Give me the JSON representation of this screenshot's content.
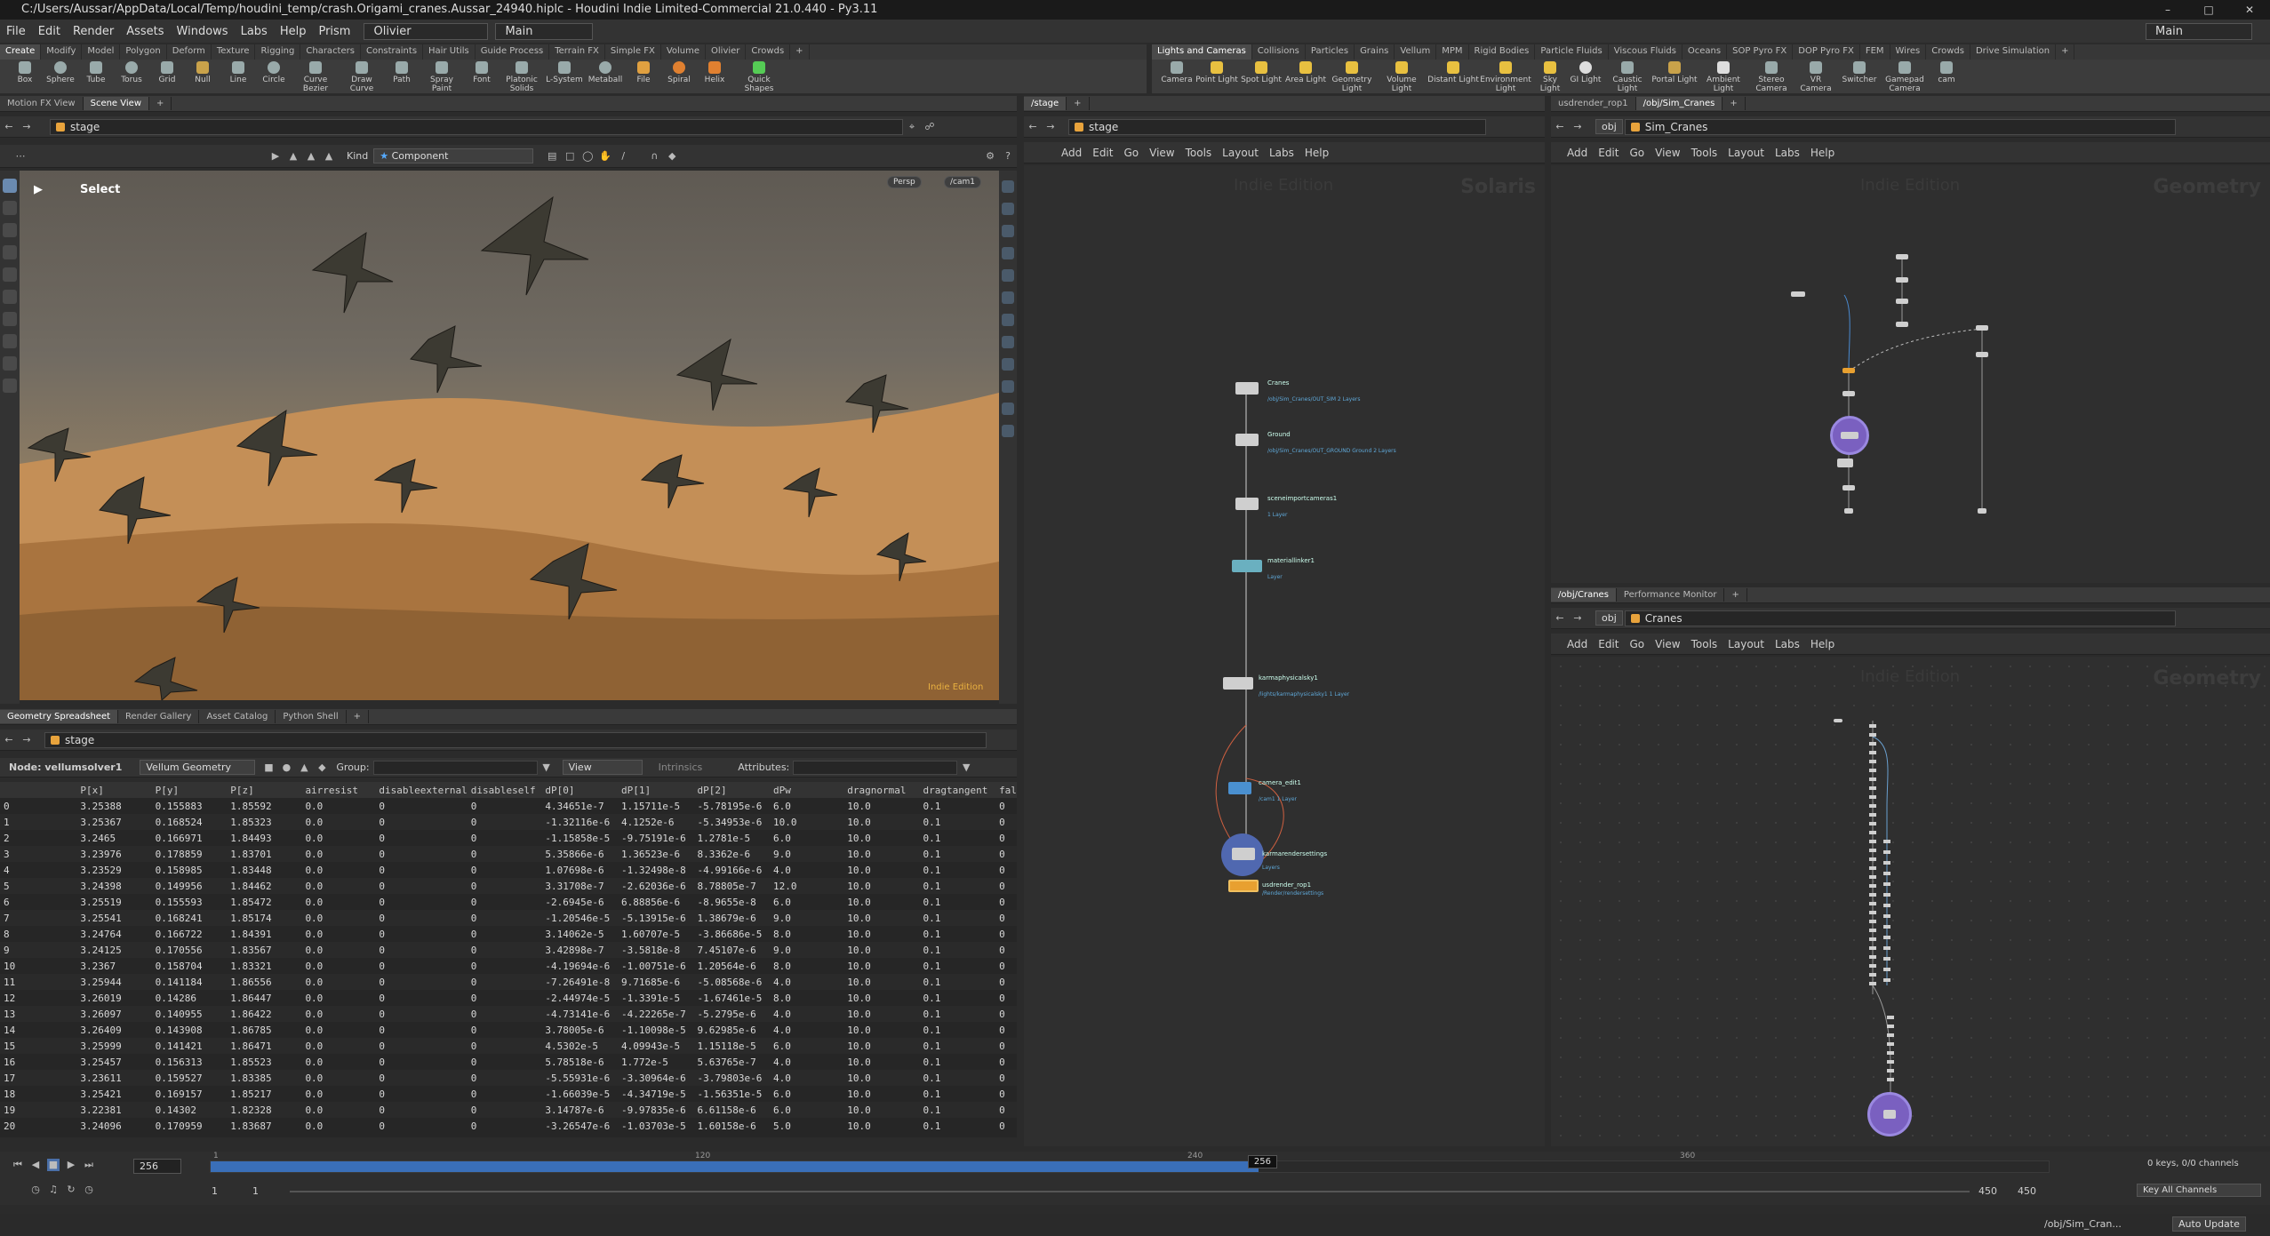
{
  "title": "C:/Users/Aussar/AppData/Local/Temp/houdini_temp/crash.Origami_cranes.Aussar_24940.hiplc - Houdini Indie Limited-Commercial 21.0.440 - Py3.11",
  "menu": [
    "File",
    "Edit",
    "Render",
    "Assets",
    "Windows",
    "Labs",
    "Help",
    "Prism"
  ],
  "desktop_left": "Olivier",
  "desktop_mid": "Main",
  "desktop_right": "Main",
  "shelf_tabs_left": [
    "Create",
    "Modify",
    "Model",
    "Polygon",
    "Deform",
    "Texture",
    "Rigging",
    "Characters",
    "Constraints",
    "Hair Utils",
    "Guide Process",
    "Terrain FX",
    "Simple FX",
    "Volume",
    "Olivier",
    "Crowds"
  ],
  "shelf_tools_left": [
    "Box",
    "Sphere",
    "Tube",
    "Torus",
    "Grid",
    "Null",
    "Line",
    "Circle",
    "Curve Bezier",
    "Draw Curve",
    "Path",
    "Spray Paint",
    "Font",
    "Platonic Solids",
    "L-System",
    "Metaball",
    "File",
    "Spiral",
    "Helix",
    "Quick Shapes"
  ],
  "shelf_tabs_right": [
    "Lights and Cameras",
    "Collisions",
    "Particles",
    "Grains",
    "Vellum",
    "MPM",
    "Rigid Bodies",
    "Particle Fluids",
    "Viscous Fluids",
    "Oceans",
    "SOP Pyro FX",
    "DOP Pyro FX",
    "FEM",
    "Wires",
    "Crowds",
    "Drive Simulation"
  ],
  "shelf_tools_right": [
    "Camera",
    "Point Light",
    "Spot Light",
    "Area Light",
    "Geometry Light",
    "Volume Light",
    "Distant Light",
    "Environment Light",
    "Sky Light",
    "GI Light",
    "Caustic Light",
    "Portal Light",
    "Ambient Light",
    "Stereo Camera",
    "VR Camera",
    "Switcher",
    "Gamepad Camera",
    "cam"
  ],
  "viewport": {
    "tabs": [
      "Motion FX View",
      "Scene View"
    ],
    "path": "stage",
    "kind_label": "Kind",
    "kind_value": "Component",
    "tool": "Select",
    "persp": "Persp",
    "cam": "/cam1",
    "watermark": "Indie Edition"
  },
  "spreadsheet": {
    "tabs": [
      "Geometry Spreadsheet",
      "Render Gallery",
      "Asset Catalog",
      "Python Shell"
    ],
    "path": "stage",
    "node_label": "Node: vellumsolver1",
    "mode": "Vellum Geometry",
    "group_label": "Group:",
    "view_label": "View",
    "intrinsics_label": "Intrinsics",
    "attributes_label": "Attributes:",
    "columns": [
      "",
      "P[x]",
      "P[y]",
      "P[z]",
      "airresist",
      "disableexternal",
      "disableself",
      "dP[0]",
      "dP[1]",
      "dP[2]",
      "dPw",
      "dragnormal",
      "dragtangent",
      "fal"
    ],
    "rows": [
      [
        "0",
        "3.25388",
        "0.155883",
        "1.85592",
        "0.0",
        "0",
        "0",
        "4.34651e-7",
        "1.15711e-5",
        "-5.78195e-6",
        "6.0",
        "10.0",
        "0.1",
        "0"
      ],
      [
        "1",
        "3.25367",
        "0.168524",
        "1.85323",
        "0.0",
        "0",
        "0",
        "-1.32116e-6",
        "4.1252e-6",
        "-5.34953e-6",
        "10.0",
        "10.0",
        "0.1",
        "0"
      ],
      [
        "2",
        "3.2465",
        "0.166971",
        "1.84493",
        "0.0",
        "0",
        "0",
        "-1.15858e-5",
        "-9.75191e-6",
        "1.2781e-5",
        "6.0",
        "10.0",
        "0.1",
        "0"
      ],
      [
        "3",
        "3.23976",
        "0.178859",
        "1.83701",
        "0.0",
        "0",
        "0",
        "5.35866e-6",
        "1.36523e-6",
        "8.3362e-6",
        "9.0",
        "10.0",
        "0.1",
        "0"
      ],
      [
        "4",
        "3.23529",
        "0.158985",
        "1.83448",
        "0.0",
        "0",
        "0",
        "1.07698e-6",
        "-1.32498e-8",
        "-4.99166e-6",
        "4.0",
        "10.0",
        "0.1",
        "0"
      ],
      [
        "5",
        "3.24398",
        "0.149956",
        "1.84462",
        "0.0",
        "0",
        "0",
        "3.31708e-7",
        "-2.62036e-6",
        "8.78805e-7",
        "12.0",
        "10.0",
        "0.1",
        "0"
      ],
      [
        "6",
        "3.25519",
        "0.155593",
        "1.85472",
        "0.0",
        "0",
        "0",
        "-2.6945e-6",
        "6.88856e-6",
        "-8.9655e-8",
        "6.0",
        "10.0",
        "0.1",
        "0"
      ],
      [
        "7",
        "3.25541",
        "0.168241",
        "1.85174",
        "0.0",
        "0",
        "0",
        "-1.20546e-5",
        "-5.13915e-6",
        "1.38679e-6",
        "9.0",
        "10.0",
        "0.1",
        "0"
      ],
      [
        "8",
        "3.24764",
        "0.166722",
        "1.84391",
        "0.0",
        "0",
        "0",
        "3.14062e-5",
        "1.60707e-5",
        "-3.86686e-5",
        "8.0",
        "10.0",
        "0.1",
        "0"
      ],
      [
        "9",
        "3.24125",
        "0.170556",
        "1.83567",
        "0.0",
        "0",
        "0",
        "3.42898e-7",
        "-3.5818e-8",
        "7.45107e-6",
        "9.0",
        "10.0",
        "0.1",
        "0"
      ],
      [
        "10",
        "3.2367",
        "0.158704",
        "1.83321",
        "0.0",
        "0",
        "0",
        "-4.19694e-6",
        "-1.00751e-6",
        "1.20564e-6",
        "8.0",
        "10.0",
        "0.1",
        "0"
      ],
      [
        "11",
        "3.25944",
        "0.141184",
        "1.86556",
        "0.0",
        "0",
        "0",
        "-7.26491e-8",
        "9.71685e-6",
        "-5.08568e-6",
        "4.0",
        "10.0",
        "0.1",
        "0"
      ],
      [
        "12",
        "3.26019",
        "0.14286",
        "1.86447",
        "0.0",
        "0",
        "0",
        "-2.44974e-5",
        "-1.3391e-5",
        "-1.67461e-5",
        "8.0",
        "10.0",
        "0.1",
        "0"
      ],
      [
        "13",
        "3.26097",
        "0.140955",
        "1.86422",
        "0.0",
        "0",
        "0",
        "-4.73141e-6",
        "-4.22265e-7",
        "-5.2795e-6",
        "4.0",
        "10.0",
        "0.1",
        "0"
      ],
      [
        "14",
        "3.26409",
        "0.143908",
        "1.86785",
        "0.0",
        "0",
        "0",
        "3.78005e-6",
        "-1.10098e-5",
        "9.62985e-6",
        "4.0",
        "10.0",
        "0.1",
        "0"
      ],
      [
        "15",
        "3.25999",
        "0.141421",
        "1.86471",
        "0.0",
        "0",
        "0",
        "4.5302e-5",
        "4.09943e-5",
        "1.15118e-5",
        "6.0",
        "10.0",
        "0.1",
        "0"
      ],
      [
        "16",
        "3.25457",
        "0.156313",
        "1.85523",
        "0.0",
        "0",
        "0",
        "5.78518e-6",
        "1.772e-5",
        "5.63765e-7",
        "4.0",
        "10.0",
        "0.1",
        "0"
      ],
      [
        "17",
        "3.23611",
        "0.159527",
        "1.83385",
        "0.0",
        "0",
        "0",
        "-5.55931e-6",
        "-3.30964e-6",
        "-3.79803e-6",
        "4.0",
        "10.0",
        "0.1",
        "0"
      ],
      [
        "18",
        "3.25421",
        "0.169157",
        "1.85217",
        "0.0",
        "0",
        "0",
        "-1.66039e-5",
        "-4.34719e-5",
        "-1.56351e-5",
        "6.0",
        "10.0",
        "0.1",
        "0"
      ],
      [
        "19",
        "3.22381",
        "0.14302",
        "1.82328",
        "0.0",
        "0",
        "0",
        "3.14787e-6",
        "-9.97835e-6",
        "6.61158e-6",
        "6.0",
        "10.0",
        "0.1",
        "0"
      ],
      [
        "20",
        "3.24096",
        "0.170959",
        "1.83687",
        "0.0",
        "0",
        "0",
        "-3.26547e-6",
        "-1.03703e-5",
        "1.60158e-6",
        "5.0",
        "10.0",
        "0.1",
        "0"
      ]
    ]
  },
  "stage_net": {
    "tab": "/stage",
    "path": "stage",
    "menu": [
      "Add",
      "Edit",
      "Go",
      "View",
      "Tools",
      "Layout",
      "Labs",
      "Help"
    ],
    "wm_indie": "Indie Edition",
    "wm_ctx": "Solaris",
    "nodes": [
      {
        "name": "Cranes",
        "sub": "/obj/Sim_Cranes/OUT_SIM\n2 Layers"
      },
      {
        "name": "Ground",
        "sub": "/obj/Sim_Cranes/OUT_GROUND\nGround\n2 Layers"
      },
      {
        "name": "sceneimportcameras1",
        "sub": "1 Layer"
      },
      {
        "name": "materiallinker1",
        "sub": "Layer"
      },
      {
        "name": "karmaphysicalsky1",
        "sub": "/lights/karmaphysicalsky1\n1 Layer"
      },
      {
        "name": "camera_edit1",
        "sub": "/cam1\n1 Layer"
      },
      {
        "name": "karmarendersettings",
        "sub": "Layers"
      },
      {
        "name": "usdrender_rop1",
        "sub": "/Render/rendersettings"
      }
    ]
  },
  "sim_net": {
    "tabs": [
      "usdrender_rop1",
      "/obj/Sim_Cranes"
    ],
    "path_root": "obj",
    "path": "Sim_Cranes",
    "menu": [
      "Add",
      "Edit",
      "Go",
      "View",
      "Tools",
      "Layout",
      "Labs",
      "Help"
    ],
    "wm_indie": "Indie Edition",
    "wm_ctx": "Geometry"
  },
  "cranes_net": {
    "tabs": [
      "/obj/Cranes",
      "Performance Monitor"
    ],
    "path_root": "obj",
    "path": "Cranes",
    "menu": [
      "Add",
      "Edit",
      "Go",
      "View",
      "Tools",
      "Layout",
      "Labs",
      "Help"
    ],
    "wm_indie": "Indie Edition",
    "wm_ctx": "Geometry"
  },
  "timeline": {
    "current_frame": "256",
    "frame_badge": "256",
    "ticks": [
      "1",
      "120",
      "240",
      "360"
    ],
    "start": "1",
    "start2": "1",
    "end": "450",
    "end2": "450",
    "keys_info": "0 keys, 0/0 channels",
    "key_all": "Key All Channels",
    "progress": 0.57
  },
  "status": {
    "path": "/obj/Sim_Cran...",
    "auto_update": "Auto Update"
  }
}
